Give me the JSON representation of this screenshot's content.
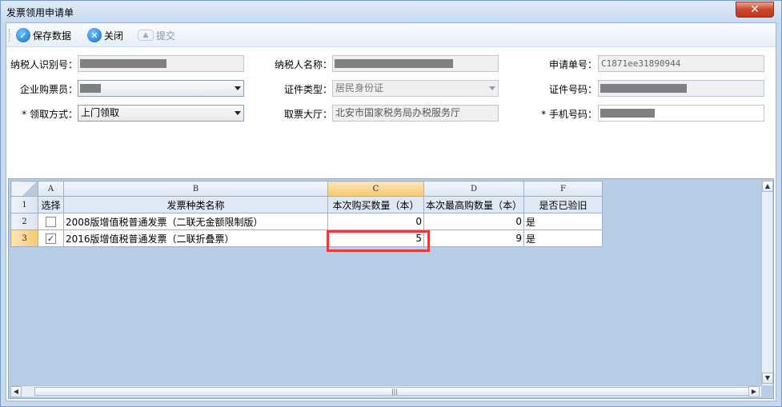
{
  "window": {
    "title": "发票领用申请单",
    "close_glyph": "✕"
  },
  "toolbar": {
    "save_label": "保存数据",
    "close_label": "关闭",
    "submit_label": "提交"
  },
  "form": {
    "taxpayer_id_label": "纳税人识别号：",
    "taxpayer_name_label": "纳税人名称：",
    "application_no_label": "申请单号：",
    "application_no_value": "C1871ee31890944",
    "buyer_label": "企业购票员：",
    "id_type_label": "证件类型：",
    "id_type_value": "居民身份证",
    "id_number_label": "证件号码：",
    "pickup_method_label": "*  领取方式：",
    "pickup_method_value": "上门领取",
    "hall_label": "取票大厅：",
    "hall_value": "北安市国家税务局办税服务厅",
    "phone_label": "*  手机号码："
  },
  "grid": {
    "column_letters": [
      "A",
      "B",
      "C",
      "D",
      "F"
    ],
    "row_numbers": [
      "1",
      "2",
      "3"
    ],
    "headers": [
      "选择",
      "发票种类名称",
      "本次购买数量（本）",
      "本次最高购数量（本）",
      "是否已验旧"
    ],
    "rows": [
      {
        "checked": "",
        "name": "2008版增值税普通发票（二联无金额限制版）",
        "qty": "0",
        "max_qty": "0",
        "verified": "是"
      },
      {
        "checked": "✓",
        "name": "2016版增值税普通发票（二联折叠票）",
        "qty": "5",
        "max_qty": "9",
        "verified": "是"
      }
    ]
  },
  "scrollbar": {
    "up": "▲",
    "down": "▼",
    "left": "◀",
    "right": "▶",
    "grip": "|||"
  }
}
